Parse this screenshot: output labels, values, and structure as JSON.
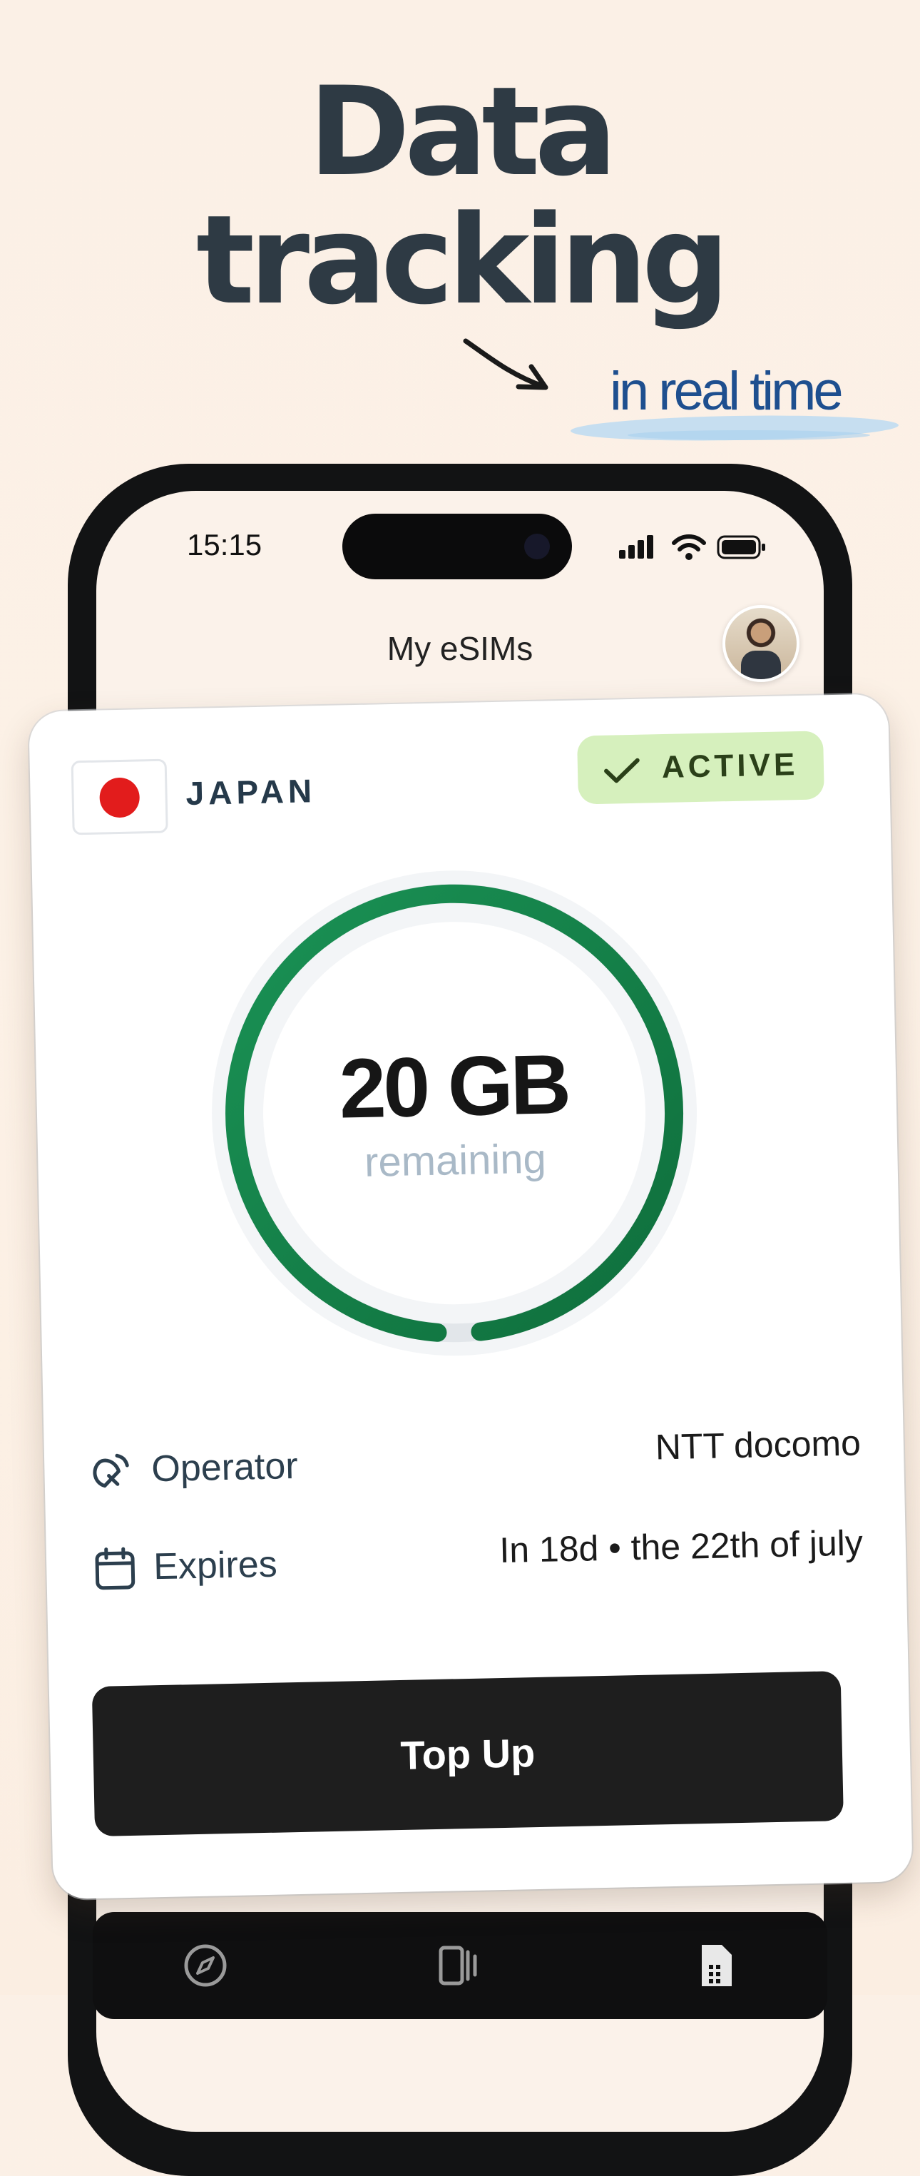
{
  "headline": {
    "line1": "Data",
    "line2": "tracking",
    "tagline": "in real time"
  },
  "status_bar": {
    "time": "15:15"
  },
  "header": {
    "title": "My eSIMs"
  },
  "esim": {
    "country": "JAPAN",
    "status": "ACTIVE",
    "amount": "20 GB",
    "amount_caption": "remaining",
    "operator_label": "Operator",
    "operator_value": "NTT docomo",
    "expires_label": "Expires",
    "expires_value": "In 18d • the 22th of july",
    "topup_label": "Top Up"
  },
  "icons": {
    "status_icons": [
      "signal-icon",
      "wifi-icon",
      "battery-icon"
    ],
    "tabbar": [
      "compass-icon",
      "cards-icon",
      "sim-icon"
    ]
  },
  "colors": {
    "headline": "#2e3a44",
    "tagline": "#1e4f8f",
    "ring_progress": "#168a4c",
    "badge_bg": "#d6f0bd",
    "button_bg": "#1e1e1e"
  }
}
